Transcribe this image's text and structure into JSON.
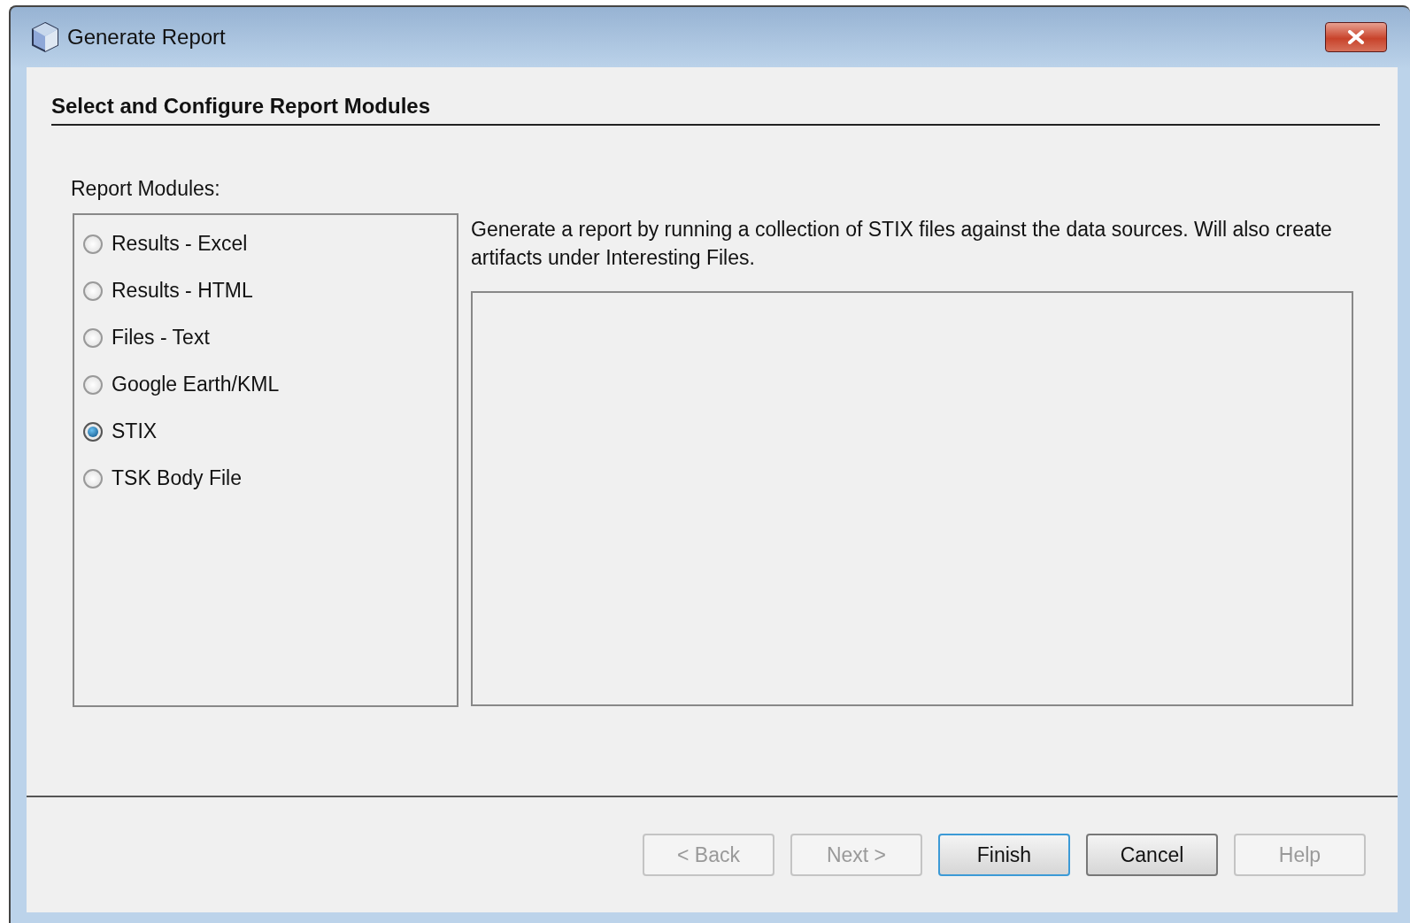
{
  "window": {
    "title": "Generate Report"
  },
  "heading": "Select and Configure Report Modules",
  "modules_label": "Report Modules:",
  "modules": [
    {
      "label": "Results - Excel",
      "selected": false
    },
    {
      "label": "Results - HTML",
      "selected": false
    },
    {
      "label": "Files - Text",
      "selected": false
    },
    {
      "label": "Google Earth/KML",
      "selected": false
    },
    {
      "label": "STIX",
      "selected": true
    },
    {
      "label": "TSK Body File",
      "selected": false
    }
  ],
  "description": "Generate a report by running a collection of STIX files against the data sources. Will also create artifacts under Interesting Files.",
  "buttons": [
    {
      "label": "< Back",
      "disabled": true,
      "focused": false
    },
    {
      "label": "Next >",
      "disabled": true,
      "focused": false
    },
    {
      "label": "Finish",
      "disabled": false,
      "focused": true
    },
    {
      "label": "Cancel",
      "disabled": false,
      "focused": false
    },
    {
      "label": "Help",
      "disabled": true,
      "focused": false
    }
  ]
}
